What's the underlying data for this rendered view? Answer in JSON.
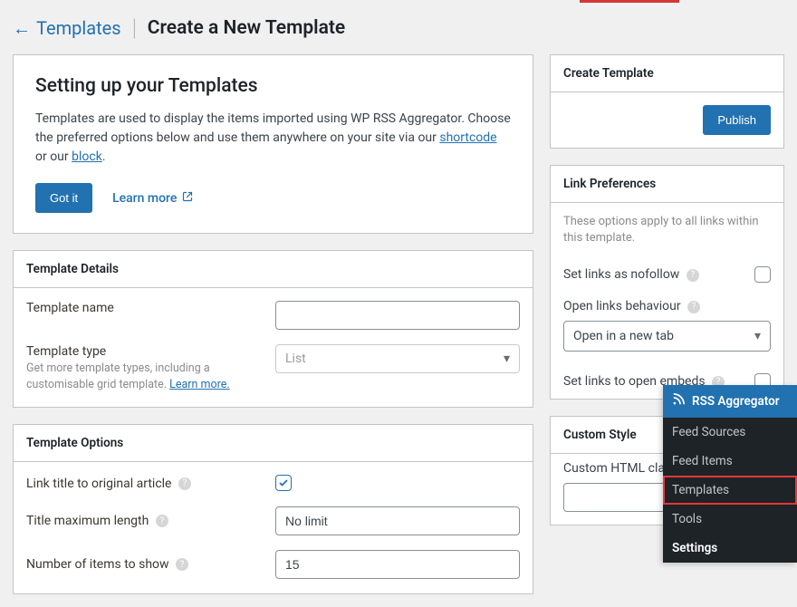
{
  "colors": {
    "accent": "#2271b1",
    "danger": "#d63638"
  },
  "breadcrumb": {
    "back_label": "Templates",
    "page_title": "Create a New Template"
  },
  "intro": {
    "heading": "Setting up your Templates",
    "line1": "Templates are used to display the items imported using WP RSS Aggregator. Choose the preferred options below and use them anywhere on your site via our ",
    "shortcode_link": "shortcode",
    "middle": " or our ",
    "block_link": "block",
    "line_end": ".",
    "got_it": "Got it",
    "learn_more": "Learn more"
  },
  "details_panel": {
    "title": "Template Details",
    "name_label": "Template name",
    "name_value": "",
    "type_label": "Template type",
    "type_sub1": "Get more template types, including a customisable grid template. ",
    "type_sub_link": "Learn more.",
    "type_value": "List"
  },
  "options_panel": {
    "title": "Template Options",
    "link_title_label": "Link title to original article",
    "link_title_checked": true,
    "title_max_label": "Title maximum length",
    "title_max_value": "No limit",
    "num_items_label": "Number of items to show",
    "num_items_value": "15"
  },
  "create_panel": {
    "title": "Create Template",
    "publish": "Publish"
  },
  "link_prefs": {
    "title": "Link Preferences",
    "note": "These options apply to all links within this template.",
    "nofollow_label": "Set links as nofollow",
    "nofollow_checked": false,
    "behaviour_label": "Open links behaviour",
    "behaviour_value": "Open in a new tab",
    "embeds_label": "Set links to open embeds",
    "embeds_checked": false
  },
  "custom_style": {
    "title": "Custom Style",
    "class_label": "Custom HTML class"
  },
  "admin_menu": {
    "head": "RSS Aggregator",
    "items": [
      "Feed Sources",
      "Feed Items",
      "Templates",
      "Tools",
      "Settings"
    ],
    "highlighted_index": 2,
    "bold_index": 4
  }
}
